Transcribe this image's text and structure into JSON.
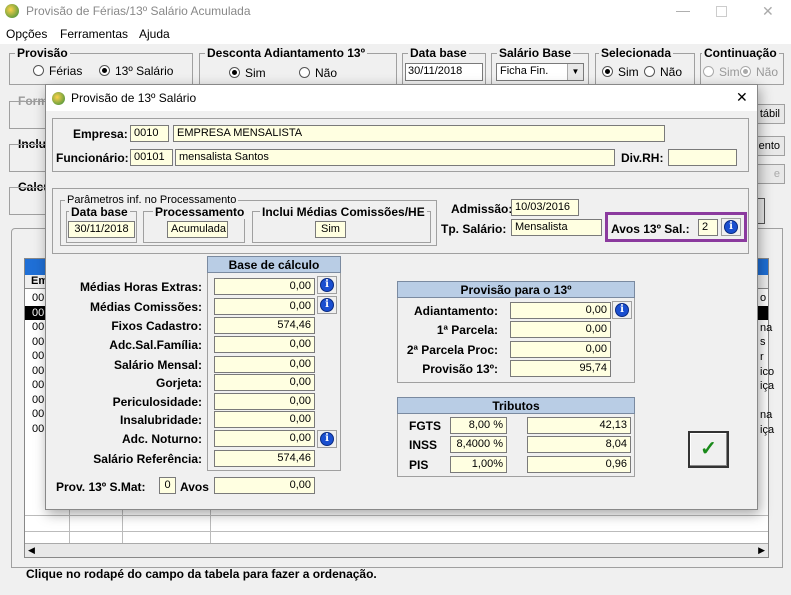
{
  "main_window": {
    "title": "Provisão de Férias/13º Salário Acumulada",
    "menu": [
      "Opções",
      "Ferramentas",
      "Ajuda"
    ],
    "provisao": {
      "label": "Provisão",
      "options": [
        "Férias",
        "13º Salário"
      ],
      "selected": "13º Salário"
    },
    "desconta": {
      "label": "Desconta Adiantamento 13º",
      "options": [
        "Sim",
        "Não"
      ],
      "selected": "Sim"
    },
    "data_base": {
      "label": "Data base",
      "value": "30/11/2018"
    },
    "salario_base": {
      "label": "Salário Base",
      "value": "Ficha Fin."
    },
    "selecionada": {
      "label": "Selecionada",
      "options": [
        "Sim",
        "Não"
      ],
      "selected": "Sim"
    },
    "continuacao": {
      "label": "Continuação",
      "options": [
        "Sim",
        "Não"
      ],
      "selected": "Não"
    },
    "partial_labels": {
      "form": "Form",
      "inclu": "Inclu",
      "calcu": "Calcu"
    },
    "right_buttons": {
      "contabil": "tábil",
      "documento": "ento",
      "other": "e"
    },
    "table": {
      "header_first": "Em",
      "rows": [
        "00",
        "00",
        "00",
        "00",
        "00",
        "00",
        "00",
        "00",
        "00",
        "00"
      ],
      "right_partial": [
        "o",
        "na",
        "s",
        "r",
        "ico",
        "iça",
        "na",
        "iça"
      ]
    },
    "status_text": "Clique no rodapé do campo da tabela  para fazer a ordenação."
  },
  "dialog": {
    "title": "Provisão de 13º Salário",
    "close_label": "✕",
    "empresa": {
      "label": "Empresa:",
      "code": "0010",
      "name": "EMPRESA MENSALISTA"
    },
    "funcionario": {
      "label": "Funcionário:",
      "code": "00101",
      "name": "mensalista Santos"
    },
    "div_rh": {
      "label": "Div.RH:",
      "value": ""
    },
    "parametros": {
      "title": "Parâmetros inf. no Processamento",
      "data_base": {
        "label": "Data base",
        "value": "30/11/2018"
      },
      "processamento": {
        "label": "Processamento",
        "value": "Acumulada"
      },
      "inclui_medias": {
        "label": "Inclui Médias Comissões/HE",
        "value": "Sim"
      }
    },
    "admissao": {
      "label": "Admissão:",
      "value": "10/03/2016"
    },
    "tp_salario": {
      "label": "Tp. Salário:",
      "value": "Mensalista"
    },
    "avos": {
      "label": "Avos 13º Sal.:",
      "value": "2"
    },
    "base_calculo": {
      "title": "Base de cálculo",
      "rows": [
        {
          "label": "Médias Horas Extras:",
          "value": "0,00"
        },
        {
          "label": "Médias Comissões:",
          "value": "0,00"
        },
        {
          "label": "Fixos Cadastro:",
          "value": "574,46"
        },
        {
          "label": "Adc.Sal.Família:",
          "value": "0,00"
        },
        {
          "label": "Salário Mensal:",
          "value": "0,00"
        },
        {
          "label": "Gorjeta:",
          "value": "0,00"
        },
        {
          "label": "Periculosidade:",
          "value": "0,00"
        },
        {
          "label": "Insalubridade:",
          "value": "0,00"
        },
        {
          "label": "Adc. Noturno:",
          "value": "0,00"
        },
        {
          "label": "Salário Referência:",
          "value": "574,46"
        }
      ]
    },
    "prov_smat": {
      "label": "Prov. 13º S.Mat:",
      "avos_value": "0",
      "avos_label": "Avos",
      "value": "0,00"
    },
    "provisao_13": {
      "title": "Provisão para o 13º",
      "rows": [
        {
          "label": "Adiantamento:",
          "value": "0,00"
        },
        {
          "label": "1ª Parcela:",
          "value": "0,00"
        },
        {
          "label": "2ª Parcela Proc:",
          "value": "0,00"
        },
        {
          "label": "Provisão 13º:",
          "value": "95,74"
        }
      ]
    },
    "tributos": {
      "title": "Tributos",
      "rows": [
        {
          "label": "FGTS",
          "rate": "8,00 %",
          "value": "42,13"
        },
        {
          "label": "INSS",
          "rate": "8,4000 %",
          "value": "8,04"
        },
        {
          "label": "PIS",
          "rate": "1,00%",
          "value": "0,96"
        }
      ]
    },
    "ok_symbol": "✓",
    "highlight_color": "#8b3a9e"
  }
}
